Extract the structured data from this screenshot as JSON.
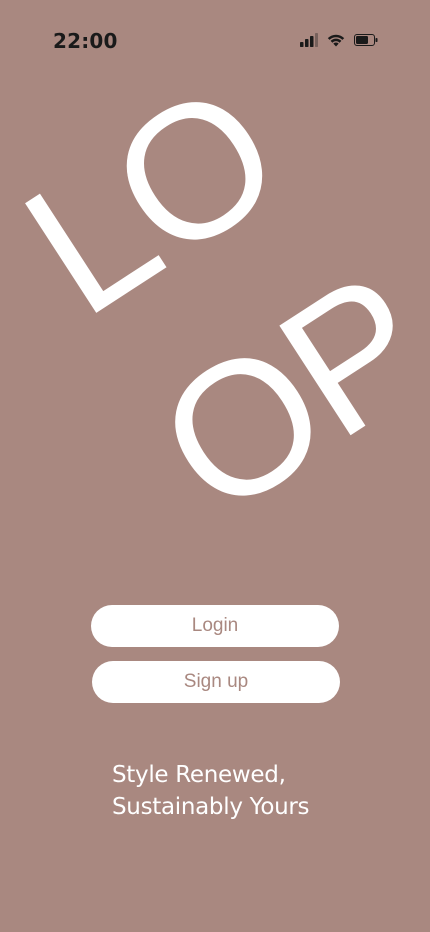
{
  "status_bar": {
    "time": "22:00",
    "icons": [
      "cellular-signal-icon",
      "wifi-icon",
      "battery-icon"
    ]
  },
  "logo": {
    "line1": "LO",
    "line2": "OP"
  },
  "actions": {
    "login_label": "Login",
    "signup_label": "Sign up"
  },
  "tagline": {
    "line1": "Style Renewed,",
    "line2": "Sustainably Yours"
  },
  "colors": {
    "background": "#a98880",
    "button_bg": "#ffffff",
    "button_text": "#a98880",
    "text": "#ffffff",
    "status_text": "#1a1a1a"
  }
}
